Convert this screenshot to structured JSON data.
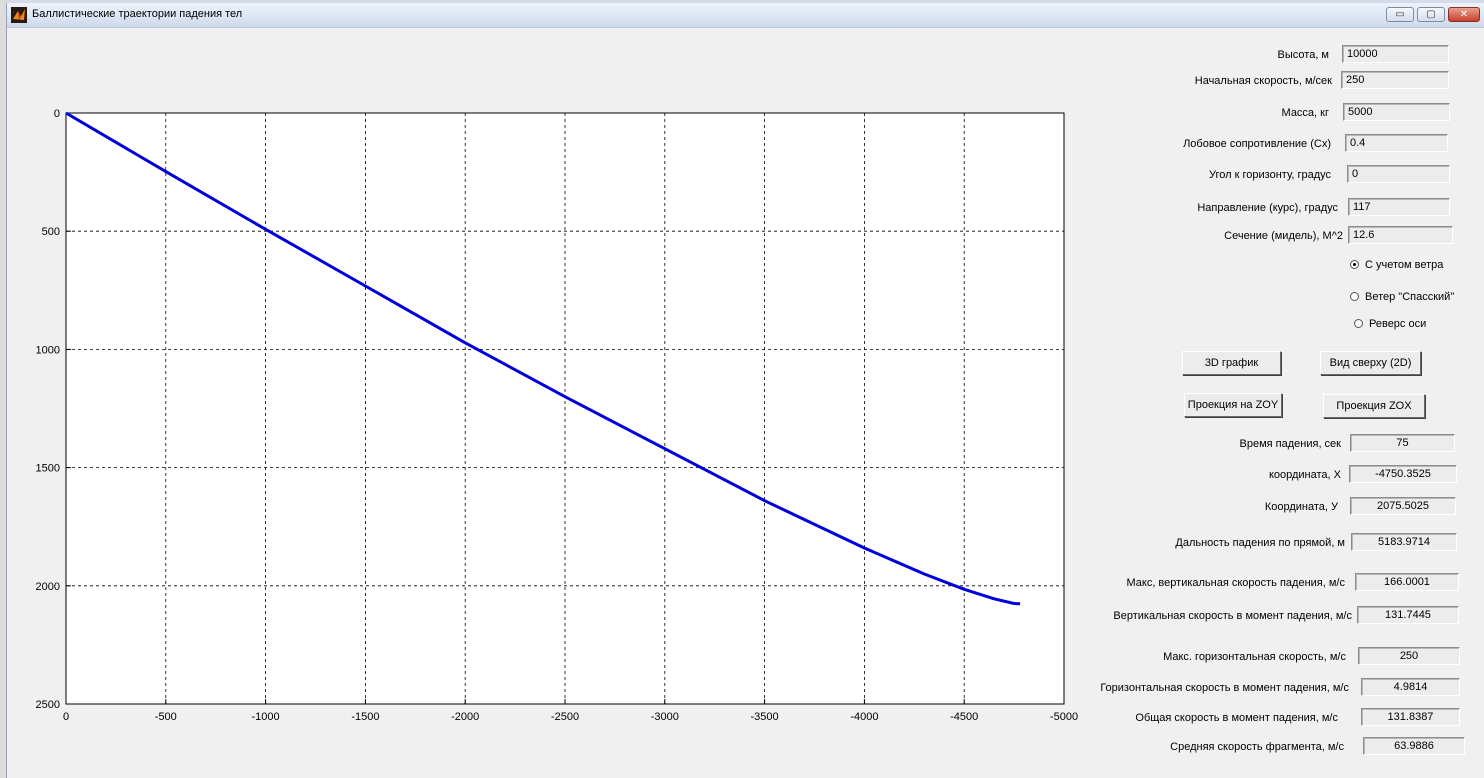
{
  "window": {
    "title": "Баллистические траектории падения тел",
    "minimize_glyph": "▭",
    "maximize_glyph": "▢",
    "close_glyph": "✕"
  },
  "params": [
    {
      "label": "Высота, м",
      "value": "10000"
    },
    {
      "label": "Начальная скорость, м/сек",
      "value": "250"
    },
    {
      "label": "Масса, кг",
      "value": "5000"
    },
    {
      "label": "Лобовое сопротивление (Cx)",
      "value": "0.4"
    },
    {
      "label": "Угол к горизонту, градус",
      "value": "0"
    },
    {
      "label": "Направление  (курс), градус",
      "value": "117"
    },
    {
      "label": "Сечение (мидель), M^2",
      "value": "12.6"
    }
  ],
  "options": [
    {
      "label": "С учетом ветра",
      "selected": true
    },
    {
      "label": "Ветер \"Спасский\"",
      "selected": false
    },
    {
      "label": "Реверс оси",
      "selected": false
    }
  ],
  "buttons": {
    "graph_3d": "3D график",
    "top_view": "Вид сверху (2D)",
    "proj_zoy": "Проекция на ZOY",
    "proj_zox": "Проекция ZOX"
  },
  "results": [
    {
      "label": "Время падения, сек",
      "value": "75"
    },
    {
      "label": "координата, X",
      "value": "-4750.3525"
    },
    {
      "label": "Координата, У",
      "value": "2075.5025"
    },
    {
      "label": "Дальность падения по прямой, м",
      "value": "5183.9714"
    },
    {
      "label": "Макс,  вертикальная скорость падения, м/с",
      "value": "166.0001"
    },
    {
      "label": "Вертикальная  скорость в момент падения, м/с",
      "value": "131.7445"
    },
    {
      "label": "Макс. горизонтальная скорость, м/с",
      "value": "250"
    },
    {
      "label": "Горизонтальная скорость в момент падения, м/с",
      "value": "4.9814"
    },
    {
      "label": "Общая скорость в момент падения, м/с",
      "value": "131.8387"
    },
    {
      "label": "Средняя скорость фрагмента, м/с",
      "value": "63.9886"
    }
  ],
  "chart_data": {
    "type": "line",
    "title": "",
    "xlabel": "",
    "ylabel": "",
    "xlim": [
      0,
      -5000
    ],
    "ylim": [
      0,
      2500
    ],
    "y_reversed": true,
    "grid": true,
    "grid_style": "dashed",
    "x_ticks": [
      0,
      -500,
      -1000,
      -1500,
      -2000,
      -2500,
      -3000,
      -3500,
      -4000,
      -4500,
      -5000
    ],
    "y_ticks": [
      0,
      500,
      1000,
      1500,
      2000,
      2500
    ],
    "color": "#0000dd",
    "series": [
      {
        "x": [
          0,
          -500,
          -1000,
          -1500,
          -2000,
          -2500,
          -3000,
          -3500,
          -4000,
          -4300,
          -4500,
          -4650,
          -4750,
          -4780
        ],
        "y": [
          0,
          248,
          492,
          732,
          972,
          1200,
          1420,
          1640,
          1840,
          1950,
          2015,
          2055,
          2075,
          2076
        ]
      }
    ]
  }
}
